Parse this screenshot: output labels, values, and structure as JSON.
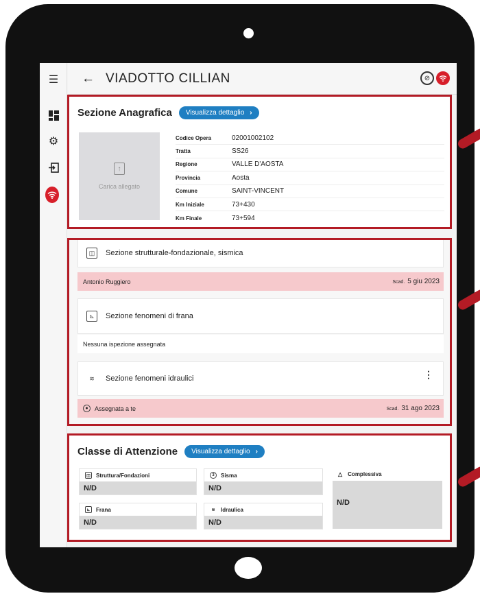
{
  "header": {
    "title": "VIADOTTO CILLIAN",
    "back_glyph": "←"
  },
  "sidebar": {
    "icons": [
      "menu-icon",
      "dashboard-icon",
      "settings-icon",
      "logout-icon",
      "wifi-icon"
    ]
  },
  "anagrafica": {
    "title": "Sezione Anagrafica",
    "detail_button": "Visualizza dettaglio",
    "upload_label": "Carica allegato",
    "rows": [
      {
        "label": "Codice Opera",
        "value": "02001002102"
      },
      {
        "label": "Tratta",
        "value": "SS26"
      },
      {
        "label": "Regione",
        "value": "VALLE D'AOSTA"
      },
      {
        "label": "Provincia",
        "value": "Aosta"
      },
      {
        "label": "Comune",
        "value": "SAINT-VINCENT"
      },
      {
        "label": "Km Iniziale",
        "value": "73+430"
      },
      {
        "label": "Km Finale",
        "value": "73+594"
      }
    ]
  },
  "sections": [
    {
      "title": "Sezione strutturale-fondazionale, sismica",
      "status": "Antonio Ruggiero",
      "due_label": "Scad.",
      "due": "5 giu 2023"
    },
    {
      "title": "Sezione fenomeni di frana",
      "status": "Nessuna ispezione assegnata"
    },
    {
      "title": "Sezione fenomeni idraulici",
      "status": "Assegnata a te",
      "due_label": "Scad.",
      "due": "31 ago 2023"
    }
  ],
  "classe": {
    "title": "Classe di Attenzione",
    "detail_button": "Visualizza dettaglio",
    "items": [
      {
        "label": "Struttura/Fondazioni",
        "value": "N/D"
      },
      {
        "label": "Sisma",
        "value": "N/D"
      },
      {
        "label": "Frana",
        "value": "N/D"
      },
      {
        "label": "Idraulica",
        "value": "N/D"
      }
    ],
    "overall": {
      "label": "Complessiva",
      "value": "N/D"
    }
  },
  "colors": {
    "accent": "#1f7fc2",
    "highlight": "#b31b25",
    "danger": "#d71f2a",
    "pink": "#f6c9cc"
  }
}
